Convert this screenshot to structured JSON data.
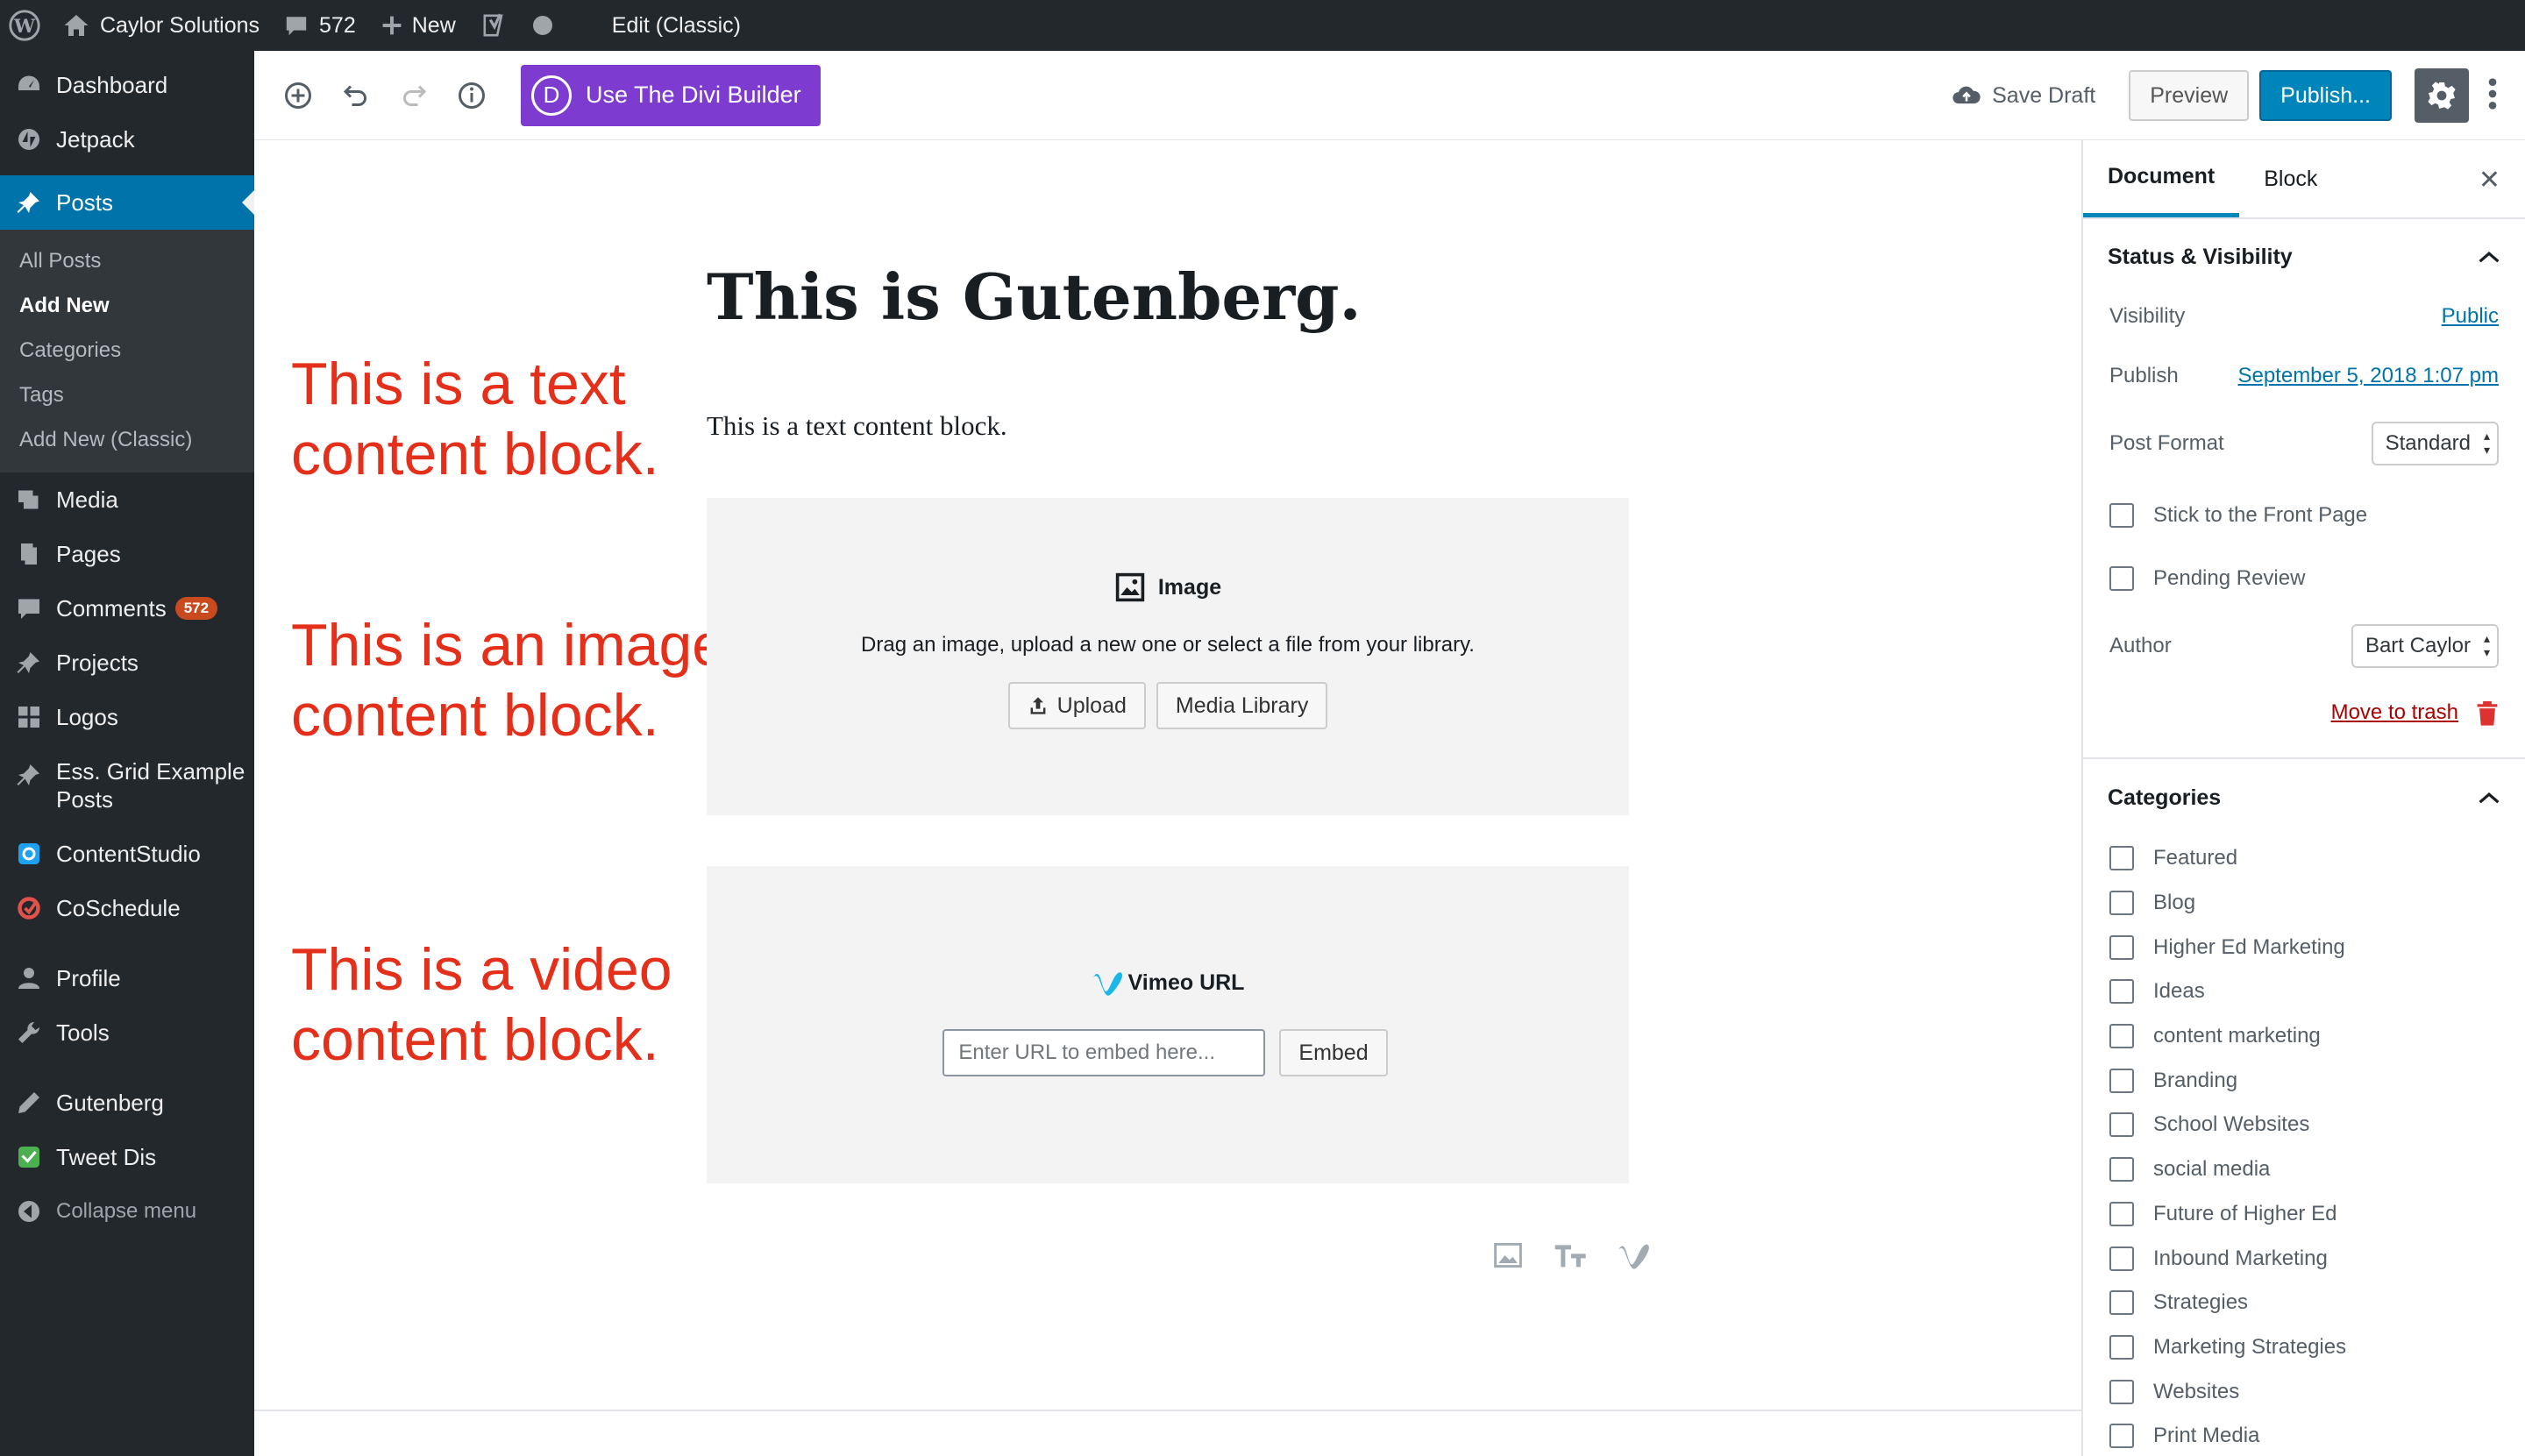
{
  "adminbar": {
    "site_name": "Caylor Solutions",
    "comments_count": "572",
    "new_label": "New",
    "edit_classic": "Edit (Classic)"
  },
  "sidebar": {
    "dashboard": "Dashboard",
    "jetpack": "Jetpack",
    "posts": "Posts",
    "posts_sub": [
      "All Posts",
      "Add New",
      "Categories",
      "Tags",
      "Add New (Classic)"
    ],
    "media": "Media",
    "pages": "Pages",
    "comments": "Comments",
    "comments_badge": "572",
    "projects": "Projects",
    "logos": "Logos",
    "ess_grid_1": "Ess. Grid Example",
    "ess_grid_2": "Posts",
    "contentstudio": "ContentStudio",
    "coschedule": "CoSchedule",
    "profile": "Profile",
    "tools": "Tools",
    "gutenberg": "Gutenberg",
    "tweet_dis": "Tweet Dis",
    "collapse": "Collapse menu"
  },
  "toolbar": {
    "divi_letter": "D",
    "divi_label": "Use The Divi Builder",
    "save_draft": "Save Draft",
    "preview": "Preview",
    "publish": "Publish..."
  },
  "annotations": {
    "text_1": "This is a text",
    "text_2": "content block.",
    "image_1": "This is an image",
    "image_2": "content block.",
    "video_1": "This is a video",
    "video_2": "content block."
  },
  "content": {
    "title": "This is Gutenberg.",
    "paragraph": "This is a text content block.",
    "image_block": {
      "title": "Image",
      "description": "Drag an image, upload a new one or select a file from your library.",
      "upload": "Upload",
      "media_library": "Media Library"
    },
    "video_block": {
      "title": "Vimeo URL",
      "placeholder": "Enter URL to embed here...",
      "embed": "Embed"
    }
  },
  "settings": {
    "tab_document": "Document",
    "tab_block": "Block",
    "close": "✕",
    "status_heading": "Status & Visibility",
    "visibility_label": "Visibility",
    "visibility_value": "Public",
    "publish_label": "Publish",
    "publish_value": "September 5, 2018 1:07 pm",
    "post_format_label": "Post Format",
    "post_format_value": "Standard",
    "stick_front": "Stick to the Front Page",
    "pending_review": "Pending Review",
    "author_label": "Author",
    "author_value": "Bart Caylor",
    "move_to_trash": "Move to trash",
    "categories_heading": "Categories",
    "categories": [
      "Featured",
      "Blog",
      "Higher Ed Marketing",
      "Ideas",
      "content marketing",
      "Branding",
      "School Websites",
      "social media",
      "Future of Higher Ed",
      "Inbound Marketing",
      "Strategies",
      "Marketing Strategies",
      "Websites",
      "Print Media"
    ]
  },
  "colors": {
    "admin_dark": "#23282d",
    "active_blue": "#0073aa",
    "divi_purple": "#7e3bd0",
    "annotation_red": "#e4301b",
    "publish_blue": "#0085ba"
  }
}
